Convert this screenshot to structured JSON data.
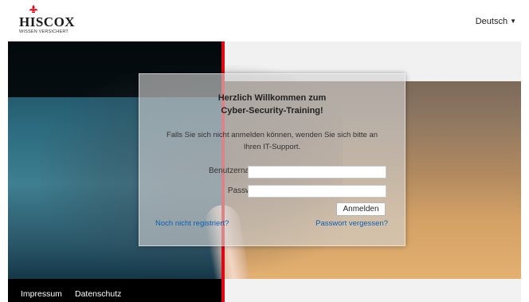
{
  "header": {
    "logo_main": "HISCOX",
    "logo_sub": "WISSEN VERSICHERT",
    "language": "Deutsch",
    "language_icon": "caret-down-icon"
  },
  "login": {
    "welcome_line1": "Herzlich Willkommen zum",
    "welcome_line2": "Cyber-Security-Training!",
    "note_line1": "Falls Sie sich nicht anmelden können, wenden Sie sich bitte an",
    "note_line2": "Ihren IT-Support.",
    "username_label": "Benutzername",
    "username_value": "",
    "password_label": "Passwort",
    "password_value": "",
    "submit_label": "Anmelden",
    "register_link": "Noch nicht registriert?",
    "forgot_link": "Passwort vergessen?"
  },
  "footer": {
    "impressum": "Impressum",
    "datenschutz": "Datenschutz"
  },
  "colors": {
    "accent_red": "#e30613",
    "link_blue": "#0a5fb4",
    "footer_bg": "#000000"
  }
}
